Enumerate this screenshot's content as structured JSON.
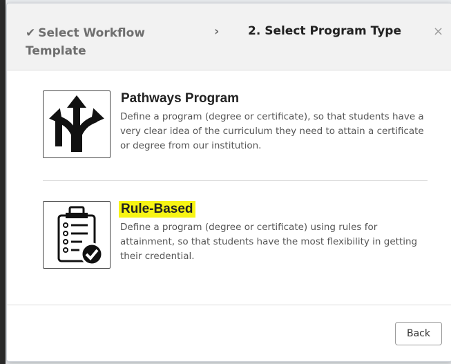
{
  "wizard": {
    "step1_label": "Select Workflow Template",
    "step_separator": "›",
    "step2_label": "2. Select Program Type",
    "close_label": "×"
  },
  "options": [
    {
      "title": "Pathways Program",
      "description": "Define a program (degree or certificate), so that students have a very clear idea of the curriculum they need to attain a certificate or degree from our institution.",
      "icon": "diverging-arrows-icon"
    },
    {
      "title": "Rule-Based",
      "description": "Define a program (degree or certificate) using rules for attainment, so that students have the most flexibility in getting their credential.",
      "icon": "checklist-clipboard-icon",
      "highlight_color": "#f7f414"
    }
  ],
  "footer": {
    "back_label": "Back"
  }
}
